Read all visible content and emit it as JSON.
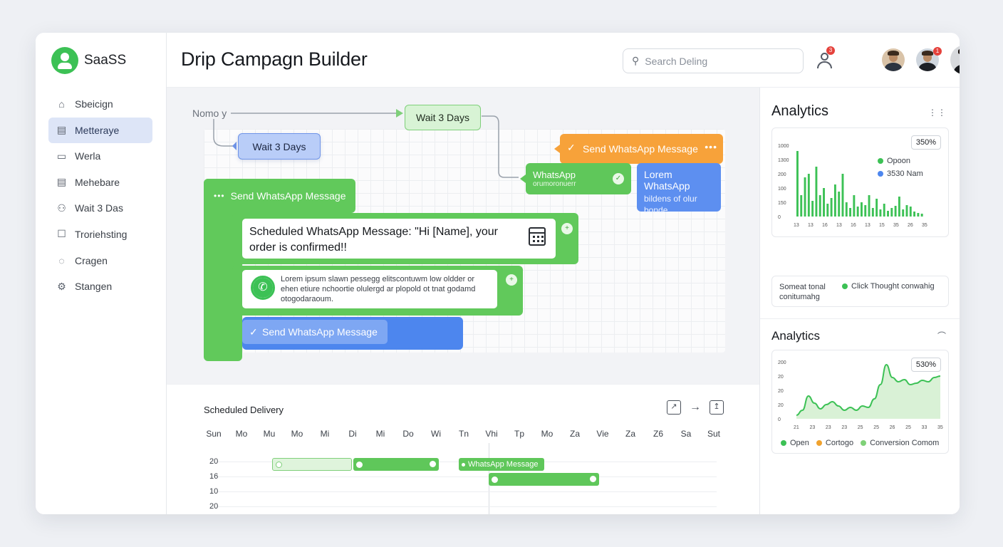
{
  "app": {
    "brand": "SaaSS",
    "title": "Drip Campagn Builder"
  },
  "sidebar": {
    "items": [
      {
        "label": "Sbeicign",
        "icon": "home-icon"
      },
      {
        "label": "Metteraye",
        "icon": "calendar-icon",
        "active": true
      },
      {
        "label": "Werla",
        "icon": "clipboard-icon"
      },
      {
        "label": "Mehebare",
        "icon": "document-icon"
      },
      {
        "label": "Wait 3 Das",
        "icon": "users-icon"
      },
      {
        "label": "Troriehsting",
        "icon": "box-icon"
      },
      {
        "label": "Cragen",
        "icon": "chat-icon"
      },
      {
        "label": "Stangen",
        "icon": "settings-icon"
      }
    ]
  },
  "header": {
    "search_placeholder": "Search Deling",
    "user_badge": "3",
    "avatar_badge": "1"
  },
  "canvas": {
    "label": "Nomo y",
    "wait_top": "Wait 3 Days",
    "wait_left": "Wait 3 Days",
    "orange_node": "Send WhatsApp Message",
    "wa_small": {
      "title": "WhatsApp",
      "sub": "orumoronuerr"
    },
    "blue_side": {
      "title": "Lorem WhatsApp",
      "sub": "bildens of olur bonde"
    },
    "send_main": "Send WhatsApp Message",
    "scheduled_text": "Scheduled WhatsApp Message: \"Hi [Name], your order is confirmed!!",
    "lorem_text": "Lorem ipsum slawn pessegg elitscontuwm low oldder or ehen etiure nchoortie olulergd ar plopold ot tnat godamd otogodaraoum.",
    "send_blue": "Send WhatsApp Message"
  },
  "schedule": {
    "title": "Scheduled Delivery",
    "days": [
      "Sun",
      "Mo",
      "Mu",
      "Mo",
      "Mi",
      "Di",
      "Mi",
      "Do",
      "Wi",
      "Tn",
      "Vhi",
      "Tp",
      "Mo",
      "Za",
      "Vie",
      "Za",
      "Z6",
      "Sa",
      "Sut"
    ],
    "rows": [
      "20",
      "16",
      "10",
      "20"
    ],
    "bar_label": "WhatsApp Message"
  },
  "analytics1": {
    "title": "Analytics",
    "chip": "350%",
    "legend": [
      {
        "label": "Opoon",
        "color": "#3cc155"
      },
      {
        "label": "3530 Nam",
        "color": "#4d86ee"
      }
    ],
    "y_ticks": [
      "1000",
      "1300",
      "200",
      "100",
      "150",
      "0"
    ],
    "x_ticks": [
      "13",
      "13",
      "16",
      "13",
      "16",
      "13",
      "15",
      "35",
      "26",
      "35"
    ],
    "stats_left": "Someat tonal conitumahg",
    "stats_right": "Click Thought conwahig"
  },
  "analytics2": {
    "title": "Analytics",
    "chip": "530%",
    "y_ticks": [
      "200",
      "20",
      "20",
      "20",
      "0"
    ],
    "x_ticks": [
      "21",
      "23",
      "23",
      "23",
      "25",
      "25",
      "26",
      "25",
      "33",
      "35"
    ],
    "legend": [
      {
        "label": "Open",
        "color": "#3cc155"
      },
      {
        "label": "Cortogo",
        "color": "#f0a22e"
      },
      {
        "label": "Conversion Comom",
        "color": "#7fd178"
      }
    ]
  },
  "chart_data": [
    {
      "type": "bar",
      "title": "",
      "y_ticks": [
        "1000",
        "1300",
        "200",
        "100",
        "150",
        "0"
      ],
      "series": [
        {
          "name": "Opoon",
          "values": [
            92,
            30,
            55,
            60,
            22,
            70,
            30,
            40,
            18,
            26,
            45,
            35,
            60,
            20,
            12,
            30,
            14,
            20,
            16,
            30,
            12,
            25,
            10,
            18,
            8,
            12,
            15,
            28,
            10,
            16,
            14,
            7,
            5,
            4
          ]
        }
      ],
      "colors": [
        "#3cc155"
      ]
    },
    {
      "type": "area",
      "title": "",
      "x": [
        0,
        1,
        2,
        3,
        4,
        5,
        6,
        7,
        8,
        9,
        10,
        11,
        12,
        13,
        14,
        15,
        16,
        17,
        18,
        19,
        20,
        21,
        22,
        23,
        24
      ],
      "series": [
        {
          "name": "Open",
          "values": [
            5,
            12,
            32,
            22,
            14,
            20,
            24,
            18,
            12,
            16,
            12,
            18,
            16,
            28,
            48,
            76,
            58,
            52,
            55,
            48,
            50,
            54,
            52,
            58,
            60
          ]
        }
      ],
      "colors": [
        "#3cc155"
      ]
    }
  ]
}
